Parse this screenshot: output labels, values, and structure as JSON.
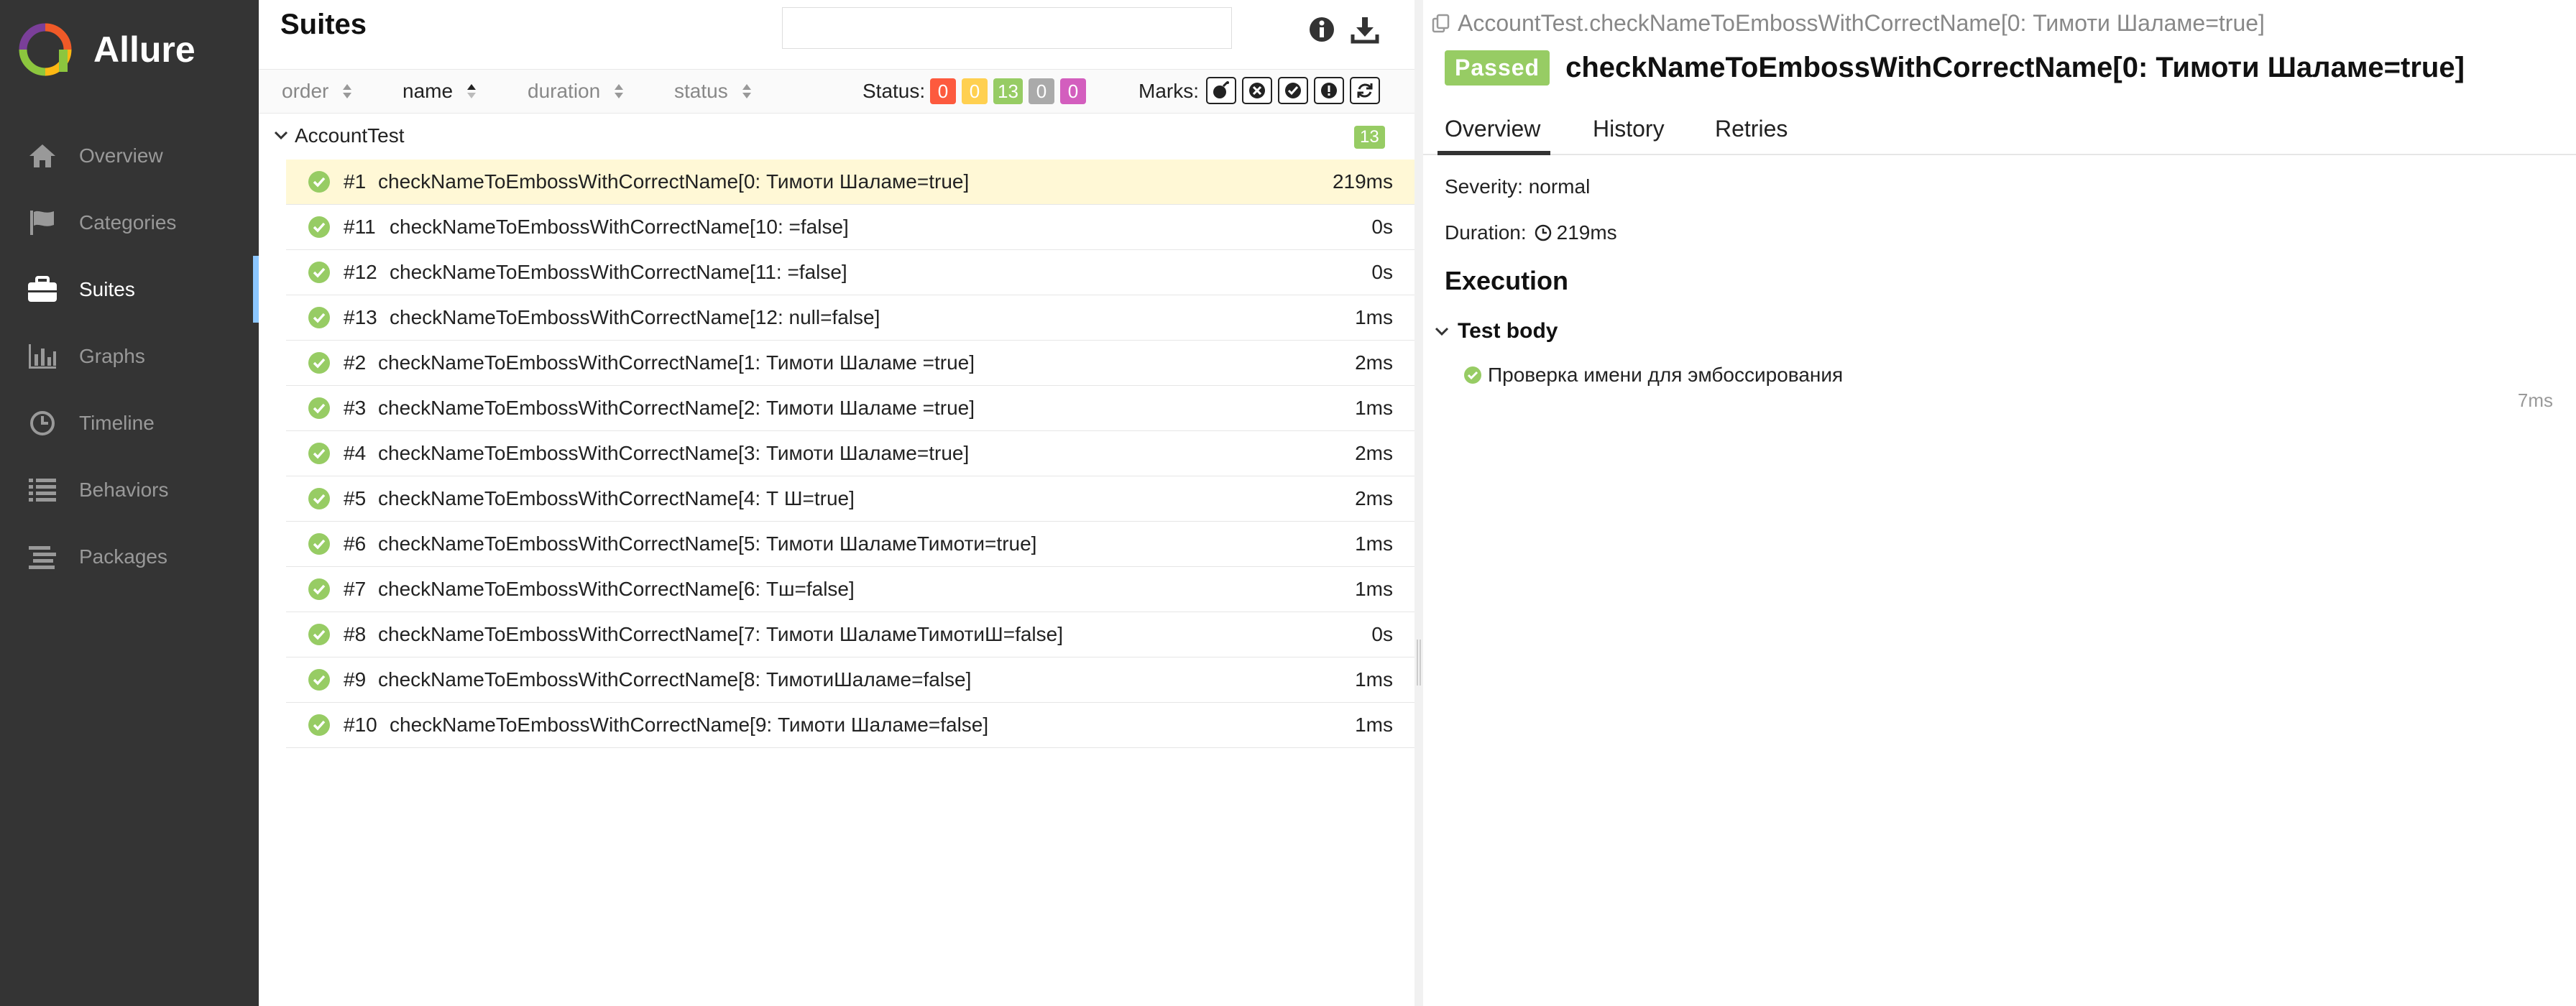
{
  "app": {
    "name": "Allure"
  },
  "sidebar": {
    "items": [
      {
        "label": "Overview",
        "icon": "home-icon"
      },
      {
        "label": "Categories",
        "icon": "flag-icon"
      },
      {
        "label": "Suites",
        "icon": "briefcase-icon",
        "active": true
      },
      {
        "label": "Graphs",
        "icon": "bar-chart-icon"
      },
      {
        "label": "Timeline",
        "icon": "clock-icon"
      },
      {
        "label": "Behaviors",
        "icon": "list-icon"
      },
      {
        "label": "Packages",
        "icon": "packages-icon"
      }
    ]
  },
  "suites": {
    "title": "Suites",
    "search": {
      "value": "",
      "placeholder": ""
    },
    "sort": {
      "order": "order",
      "name": "name",
      "duration": "duration",
      "status": "status"
    },
    "status_label": "Status:",
    "status_counts": [
      {
        "value": "0",
        "color": "#fd5a3e",
        "kind": "failed"
      },
      {
        "value": "0",
        "color": "#ffd050",
        "kind": "broken"
      },
      {
        "value": "13",
        "color": "#97cc64",
        "kind": "passed"
      },
      {
        "value": "0",
        "color": "#aaaaaa",
        "kind": "skipped"
      },
      {
        "value": "0",
        "color": "#d35ebe",
        "kind": "unknown"
      }
    ],
    "marks_label": "Marks:",
    "group": {
      "name": "AccountTest",
      "count": "13"
    },
    "tests": [
      {
        "num": "#1",
        "name": "checkNameToEmbossWithCorrectName[0: Тимоти Шаламе=true]",
        "duration": "219ms",
        "selected": true
      },
      {
        "num": "#11",
        "name": "checkNameToEmbossWithCorrectName[10: =false]",
        "duration": "0s"
      },
      {
        "num": "#12",
        "name": "checkNameToEmbossWithCorrectName[11: =false]",
        "duration": "0s"
      },
      {
        "num": "#13",
        "name": "checkNameToEmbossWithCorrectName[12: null=false]",
        "duration": "1ms"
      },
      {
        "num": "#2",
        "name": "checkNameToEmbossWithCorrectName[1: Тимоти Шаламе =true]",
        "duration": "2ms"
      },
      {
        "num": "#3",
        "name": "checkNameToEmbossWithCorrectName[2: Тимоти Шаламе =true]",
        "duration": "1ms"
      },
      {
        "num": "#4",
        "name": "checkNameToEmbossWithCorrectName[3: Тимоти Шаламе=true]",
        "duration": "2ms"
      },
      {
        "num": "#5",
        "name": "checkNameToEmbossWithCorrectName[4: Т Ш=true]",
        "duration": "2ms"
      },
      {
        "num": "#6",
        "name": "checkNameToEmbossWithCorrectName[5: Тимоти ШаламеТимоти=true]",
        "duration": "1ms"
      },
      {
        "num": "#7",
        "name": "checkNameToEmbossWithCorrectName[6: Тш=false]",
        "duration": "1ms"
      },
      {
        "num": "#8",
        "name": "checkNameToEmbossWithCorrectName[7: Тимоти ШаламеТимотиШ=false]",
        "duration": "0s"
      },
      {
        "num": "#9",
        "name": "checkNameToEmbossWithCorrectName[8: ТимотиШаламе=false]",
        "duration": "1ms"
      },
      {
        "num": "#10",
        "name": "checkNameToEmbossWithCorrectName[9: Тимоти Шаламе=false]",
        "duration": "1ms"
      }
    ]
  },
  "details": {
    "breadcrumb": "AccountTest.checkNameToEmbossWithCorrectName[0: Тимоти Шаламе=true]",
    "status": "Passed",
    "title": "checkNameToEmbossWithCorrectName[0: Тимоти Шаламе=true]",
    "tabs": [
      "Overview",
      "History",
      "Retries"
    ],
    "severity": "Severity: normal",
    "duration_label": "Duration:",
    "duration_value": "219ms",
    "execution_title": "Execution",
    "test_body_label": "Test body",
    "step": {
      "name": "Проверка имени для эмбоссирования",
      "duration": "7ms"
    }
  },
  "colors": {
    "sidebar_bg": "#343434",
    "passed": "#97cc64",
    "selected_row": "#fff8d6",
    "active_indicator": "#8cc7ff"
  }
}
